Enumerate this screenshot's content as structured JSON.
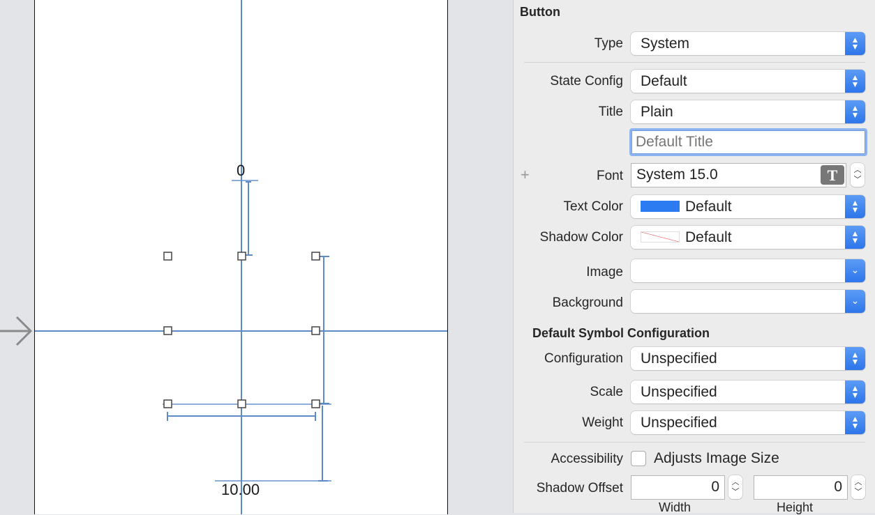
{
  "canvas": {
    "top_constraint_value": "0",
    "bottom_constraint_value": "10.00",
    "guide_color": "#5b8ac6"
  },
  "inspector": {
    "section_title": "Button",
    "type": {
      "label": "Type",
      "value": "System"
    },
    "state_config": {
      "label": "State Config",
      "value": "Default"
    },
    "title": {
      "label": "Title",
      "value": "Plain",
      "text_value": "",
      "placeholder": "Default Title"
    },
    "font": {
      "label": "Font",
      "value": "System 15.0",
      "add_icon": "+",
      "font_picker_icon": "T"
    },
    "text_color": {
      "label": "Text Color",
      "value": "Default",
      "swatch": "#2d7bf0"
    },
    "shadow_color": {
      "label": "Shadow Color",
      "value": "Default",
      "swatch": "none"
    },
    "image": {
      "label": "Image",
      "value": ""
    },
    "background": {
      "label": "Background",
      "value": ""
    },
    "symbol_section_title": "Default Symbol Configuration",
    "configuration": {
      "label": "Configuration",
      "value": "Unspecified"
    },
    "scale": {
      "label": "Scale",
      "value": "Unspecified"
    },
    "weight": {
      "label": "Weight",
      "value": "Unspecified"
    },
    "accessibility": {
      "label": "Accessibility",
      "checkbox_label": "Adjusts Image Size",
      "checked": false
    },
    "shadow_offset": {
      "label": "Shadow Offset",
      "width": "0",
      "height": "0",
      "width_label": "Width",
      "height_label": "Height"
    }
  }
}
